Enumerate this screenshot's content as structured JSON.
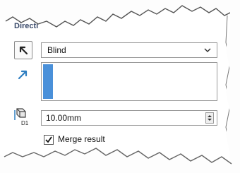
{
  "section": {
    "title": "Directi"
  },
  "reverse_button": {
    "icon": "reverse-direction-arrow-icon"
  },
  "end_condition": {
    "value": "Blind",
    "icon": "chevron-down-icon"
  },
  "direction": {
    "icon": "direction-arrow-icon"
  },
  "depth": {
    "value": "10.00mm",
    "icon": "depth-icon"
  },
  "merge": {
    "label": "Merge result",
    "checked": true
  },
  "colors": {
    "accent": "#4a90d9",
    "arrow": "#2f7fc1"
  }
}
